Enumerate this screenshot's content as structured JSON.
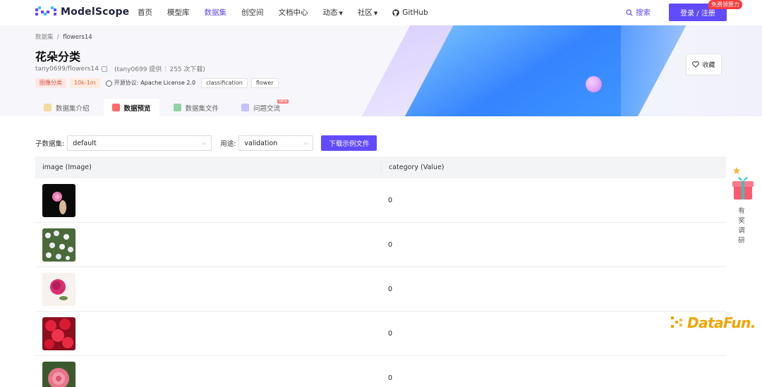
{
  "header": {
    "logo_text": "ModelScope",
    "nav": [
      {
        "label": "首页",
        "active": false,
        "dropdown": false
      },
      {
        "label": "模型库",
        "active": false,
        "dropdown": false
      },
      {
        "label": "数据集",
        "active": true,
        "dropdown": false
      },
      {
        "label": "创空间",
        "active": false,
        "dropdown": false
      },
      {
        "label": "文档中心",
        "active": false,
        "dropdown": false
      },
      {
        "label": "动态",
        "active": false,
        "dropdown": true
      },
      {
        "label": "社区",
        "active": false,
        "dropdown": true
      }
    ],
    "github_label": "GitHub",
    "search_label": "搜索",
    "login_label": "登录 / 注册",
    "promo_badge": "免费领算力"
  },
  "dataset": {
    "breadcrumb_root": "数据集",
    "breadcrumb_sep": "/",
    "breadcrumb_current": "flowers14",
    "title": "花朵分类",
    "repo_id": "tany0699/flowers14",
    "provider": "(tany0699 提供",
    "sep": "|",
    "downloads": "255 次下载)",
    "tags": {
      "task": "图像分类",
      "size": "10k-1m",
      "license_prefix": "开源协议:",
      "license": "Apache License 2.0",
      "t1": "classification",
      "t2": "flower"
    },
    "favorite_label": "收藏"
  },
  "tabs": [
    {
      "label": "数据集介绍",
      "active": false
    },
    {
      "label": "数据预览",
      "active": true
    },
    {
      "label": "数据集文件",
      "active": false
    },
    {
      "label": "问题交流",
      "active": false,
      "badge": "NEW"
    }
  ],
  "filters": {
    "subset_label": "子数据集:",
    "subset_value": "default",
    "split_label": "用途:",
    "split_value": "validation",
    "download_button": "下载示例文件"
  },
  "table": {
    "headers": [
      "image (Image)",
      "category (Value)"
    ],
    "rows": [
      {
        "category": "0"
      },
      {
        "category": "0"
      },
      {
        "category": "0"
      },
      {
        "category": "0"
      },
      {
        "category": "0"
      }
    ]
  },
  "side_widget": {
    "text": "有奖调研"
  },
  "watermark": {
    "text": "DataFun."
  },
  "colors": {
    "accent": "#624aff",
    "promo": "#ff3b3b",
    "watermark": "#f5a300"
  }
}
